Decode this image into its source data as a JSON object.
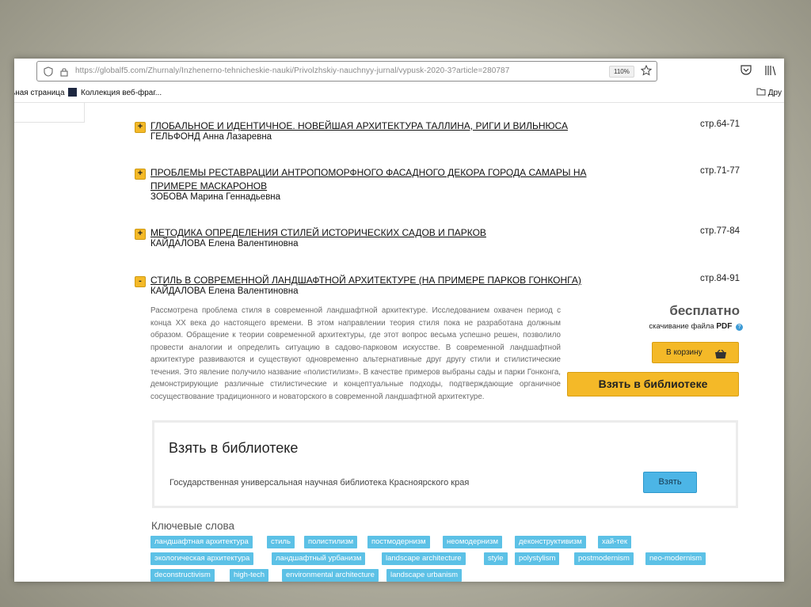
{
  "browser": {
    "url": "https://globalf5.com/Zhurnaly/Inzhenerno-tehnicheskie-nauki/Privolzhskiy-nauchnyy-jurnal/vypusk-2020-3?article=280787",
    "zoom": "110%",
    "bookmarks": {
      "left": "ьная страница",
      "collection": "Коллекция веб-фраг...",
      "right": "Дру"
    }
  },
  "articles": [
    {
      "toggle": "+",
      "title": "ГЛОБАЛЬНОЕ И ИДЕНТИЧНОЕ. НОВЕЙШАЯ АРХИТЕКТУРА ТАЛЛИНА, РИГИ И ВИЛЬНЮСА",
      "author": "ГЕЛЬФОНД Анна Лазаревна",
      "pages": "стр.64-71"
    },
    {
      "toggle": "+",
      "title": "ПРОБЛЕМЫ РЕСТАВРАЦИИ АНТРОПОМОРФНОГО ФАСАДНОГО ДЕКОРА ГОРОДА САМАРЫ НА ПРИМЕРЕ МАСКАРОНОВ",
      "author": "ЗОБОВА Марина Геннадьевна",
      "pages": "стр.71-77"
    },
    {
      "toggle": "+",
      "title": "МЕТОДИКА ОПРЕДЕЛЕНИЯ СТИЛЕЙ ИСТОРИЧЕСКИХ САДОВ И ПАРКОВ",
      "author": "КАЙДАЛОВА Елена Валентиновна",
      "pages": "стр.77-84"
    },
    {
      "toggle": "-",
      "title": "СТИЛЬ В СОВРЕМЕННОЙ ЛАНДШАФТНОЙ АРХИТЕКТУРЕ (НА ПРИМЕРЕ ПАРКОВ ГОНКОНГА)",
      "author": "КАЙДАЛОВА Елена Валентиновна",
      "pages": "стр.84-91"
    }
  ],
  "details": {
    "abstract": "Рассмотрена проблема стиля в современной ландшафтной архитектуре. Исследованием охвачен период с конца XX века до настоящего времени. В этом направлении теория стиля пока не разработана должным образом. Обращение к теории современной архитектуры, где этот вопрос весьма успешно решен, позволило провести аналогии и определить ситуацию в садово-парковом искусстве. В современной ландшафтной архитектуре развиваются и существуют одновременно альтернативные друг другу стили и стилистические течения. Это явление получило название «полистилизм». В качестве примеров выбраны сады и парки Гонконга, демонстрирующие различные стилистические и концептуальные подходы, подтверждающие органичное сосуществование традиционного и новаторского в современной ландшафтной архитектуре.",
    "price": "бесплатно",
    "download_text": "скачивание файла",
    "download_format": "PDF",
    "cart_button": "В корзину",
    "library_button": "Взять в библиотеке"
  },
  "library_panel": {
    "title": "Взять в библиотеке",
    "library_name": "Государственная универсальная научная библиотека Красноярского края",
    "take_button": "Взять"
  },
  "keywords": {
    "title": "Ключевые слова",
    "tags": [
      "ландшафтная архитектура",
      "стиль",
      "полистилизм",
      "постмодернизм",
      "неомодернизм",
      "деконструктивизм",
      "хай-тек",
      "экологическая архитектура",
      "ландшафтный урбанизм",
      "landscape architecture",
      "style",
      "polystylism",
      "postmodernism",
      "neo-modernism",
      "deconstructivism",
      "high-tech",
      "environmental architecture",
      "landscape urbanism"
    ]
  },
  "colors": {
    "accent_yellow": "#f4b928",
    "tag_blue": "#5cc1e6",
    "button_blue": "#4cb5e6"
  }
}
